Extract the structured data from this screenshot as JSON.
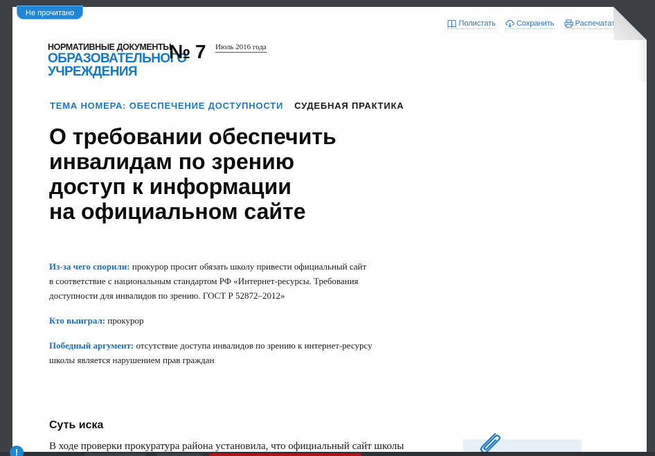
{
  "status": {
    "unread_label": "Не прочитано"
  },
  "toolbar": {
    "read_label": "Полистать",
    "save_label": "Сохранить",
    "print_label": "Распечатать"
  },
  "journal": {
    "logo_line1": "НОРМАТИВНЫЕ ДОКУМЕНТЫ",
    "logo_line2": "ОБРАЗОВАТЕЛЬНОГО",
    "logo_line3": "УЧРЕЖДЕНИЯ",
    "issue_number": "№ 7",
    "issue_date": "Июль 2016 года"
  },
  "rubrics": {
    "theme": "ТЕМА НОМЕРА: ОБЕСПЕЧЕНИЕ ДОСТУПНОСТИ",
    "section": "СУДЕБНАЯ ПРАКТИКА"
  },
  "article": {
    "title_lines": [
      "О требовании обеспечить",
      "инвалидам по зрению",
      "доступ к информации",
      "на официальном сайте"
    ],
    "summary": {
      "dispute_label": "Из-за чего спорили:",
      "dispute_line1": "прокурор просит обязать школу привести официальный сайт",
      "dispute_line2": "в соответствие с национальным стандартом РФ «Интернет-ресурсы. Требования",
      "dispute_line3": "доступности для инвалидов по зрению. ГОСТ Р 52872–2012»",
      "winner_label": "Кто выиграл:",
      "winner_text": "прокурор",
      "argument_label": "Победный аргумент:",
      "argument_line1": "отсутствие доступа инвалидов по зрению к интернет-ресурсу",
      "argument_line2": "школы является нарушением прав граждан"
    },
    "section_heading": "Суть иска",
    "body_start": "В ходе проверки прокуратура района установила, что официальный сайт школы"
  },
  "colors": {
    "accent": "#1f78c1",
    "badge": "#1f86d8",
    "background": "#3d4044"
  },
  "icons": [
    "book-icon",
    "cloud-download-icon",
    "printer-icon",
    "paperclip-icon",
    "info-icon"
  ]
}
